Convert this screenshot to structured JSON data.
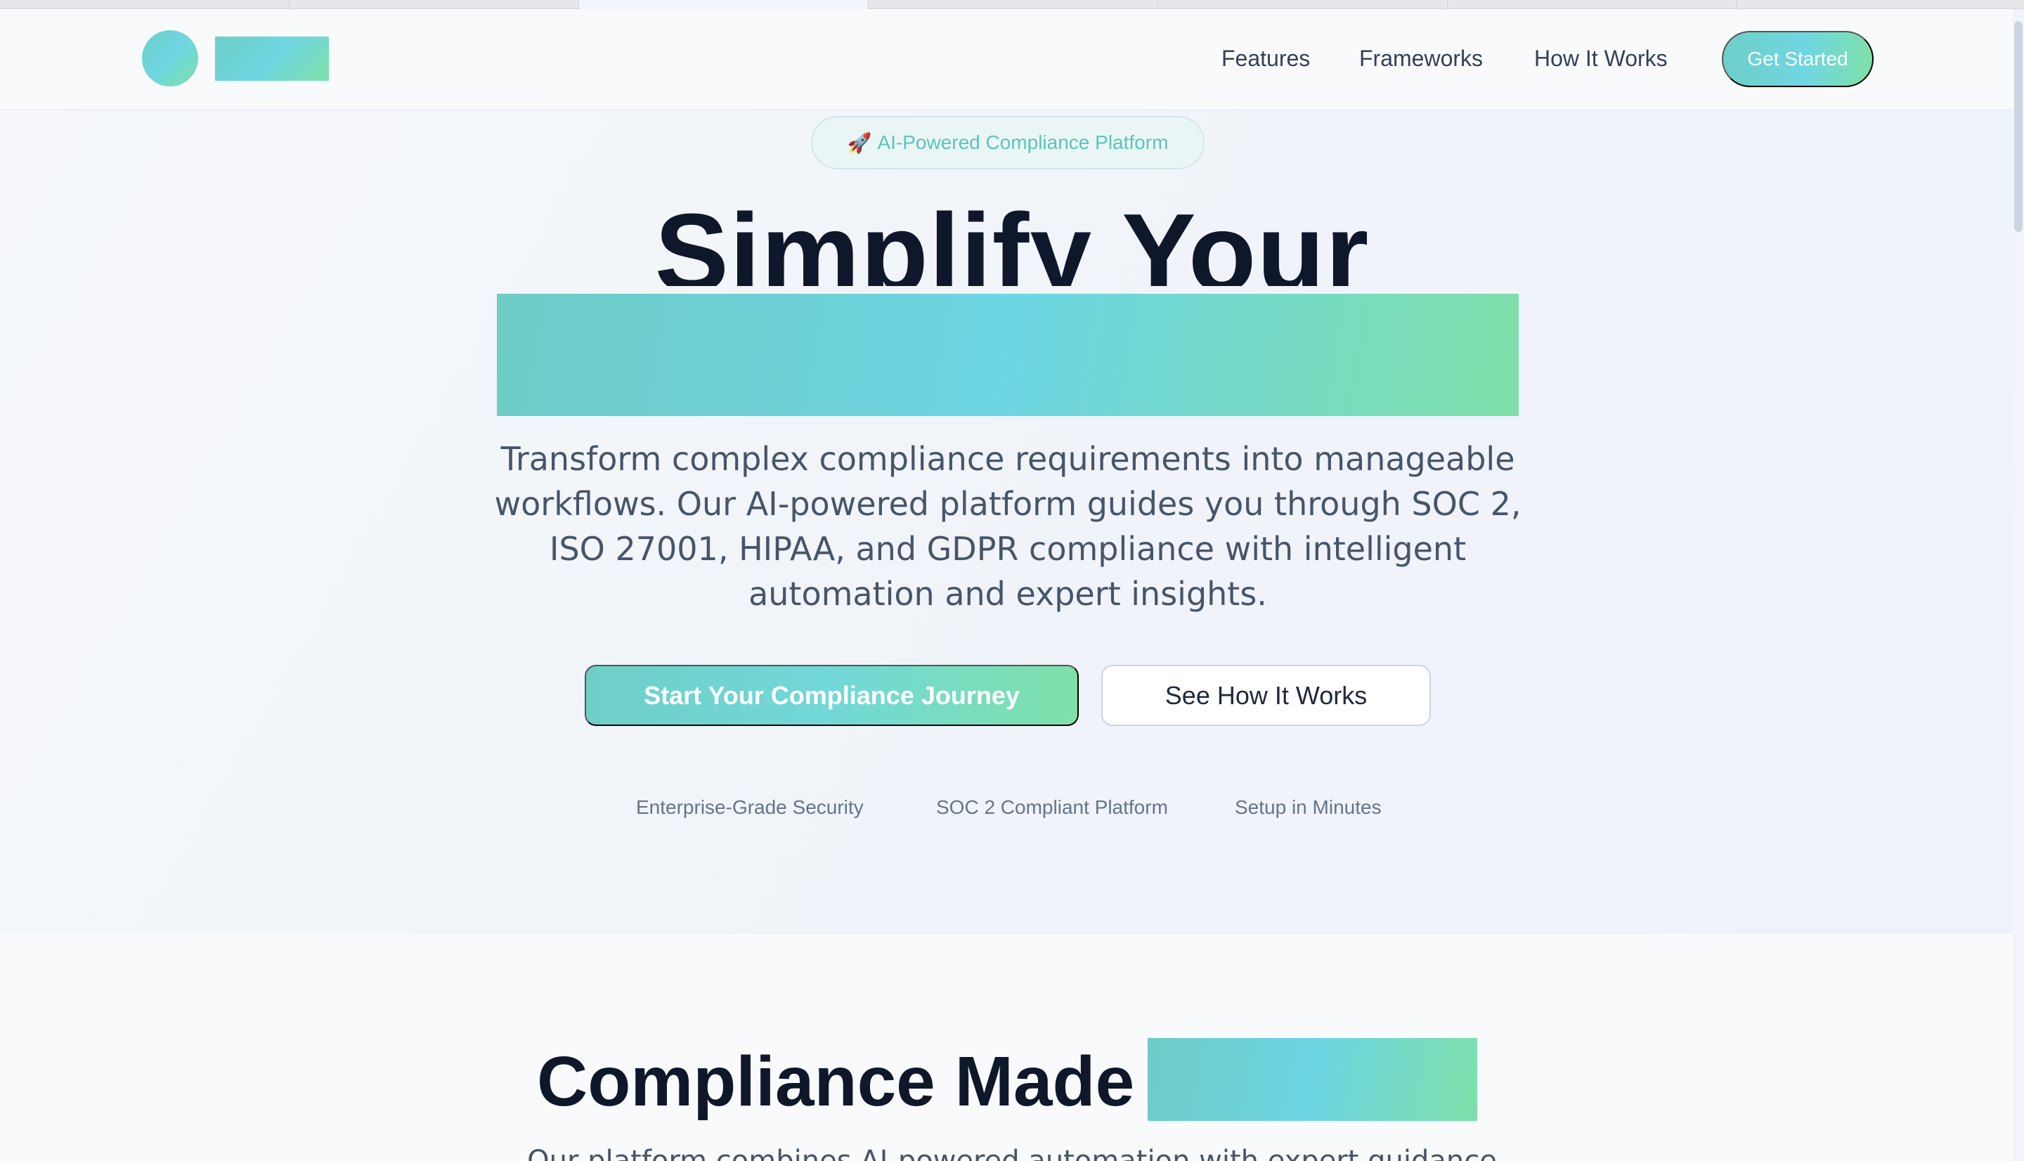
{
  "nav": {
    "links": [
      "Features",
      "Frameworks",
      "How It Works"
    ],
    "cta_label": "Get Started"
  },
  "hero": {
    "badge_icon": "rocket-icon",
    "badge_emoji": "🚀",
    "badge_text": "AI-Powered Compliance Platform",
    "title": "Simplify Your",
    "description": "Transform complex compliance requirements into manageable workflows. Our AI-powered platform guides you through SOC 2, ISO 27001, HIPAA, and GDPR compliance with intelligent automation and expert insights.",
    "primary_button": "Start Your Compliance Journey",
    "secondary_button": "See How It Works",
    "trust_items": [
      "Enterprise-Grade Security",
      "SOC 2 Compliant Platform",
      "Setup in Minutes"
    ]
  },
  "section2": {
    "title": "Compliance Made",
    "subtitle": "Our platform combines AI-powered automation with expert guidance"
  },
  "colors": {
    "accent_start": "#6ecfc7",
    "accent_mid": "#6fd6e2",
    "accent_end": "#7ee0a8",
    "heading": "#0f172a",
    "body_text": "#475569"
  }
}
